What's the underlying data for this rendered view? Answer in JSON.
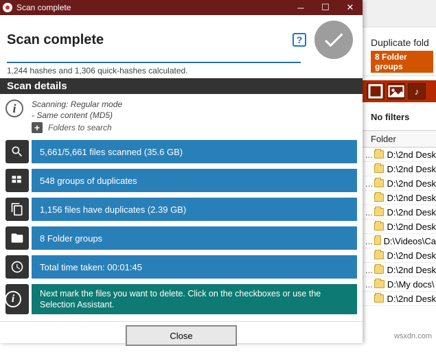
{
  "titlebar": {
    "title": "Scan complete"
  },
  "header": {
    "title": "Scan complete"
  },
  "progress": {
    "hashline": "1,244 hashes and 1,306 quick-hashes calculated."
  },
  "section": {
    "title": "Scan details"
  },
  "meta": {
    "line1": "Scanning: Regular mode",
    "line2": "- Same content (MD5)",
    "folders_to_search": "Folders to search"
  },
  "rows": {
    "scanned": "5,661/5,661 files scanned (35.6 GB)",
    "groups": "548 groups of duplicates",
    "have_dups": "1,156 files have duplicates (2.39 GB)",
    "folder_groups": "8 Folder groups",
    "time": "Total time taken: 00:01:45",
    "hint": "Next mark the files you want to delete. Click on the checkboxes or use the Selection Assistant."
  },
  "footer": {
    "close": "Close"
  },
  "side": {
    "dup_title": "Duplicate fold",
    "badge": "8 Folder groups",
    "nofilters": "No filters",
    "folder_header": "Folder",
    "items": [
      "D:\\2nd Desk",
      "D:\\2nd Desk",
      "D:\\2nd Desk",
      "D:\\2nd Desk",
      "D:\\2nd Desk",
      "D:\\2nd Desk",
      "D:\\Videos\\Ca",
      "D:\\2nd Desk",
      "D:\\2nd Desk",
      "D:\\My docs\\",
      "D:\\2nd Desk"
    ]
  },
  "watermark": "wsxdn.com"
}
